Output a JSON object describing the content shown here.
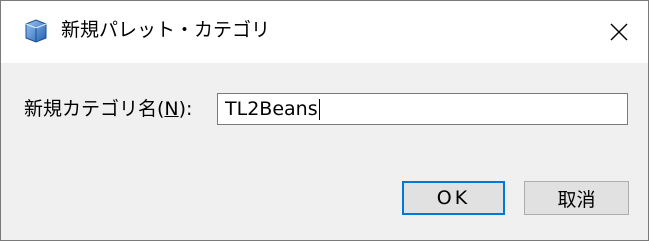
{
  "window": {
    "title": "新規パレット・カテゴリ",
    "close_glyph": "✕"
  },
  "form": {
    "label_before": "新規カテゴリ名(",
    "label_mnemonic": "N",
    "label_after": "):",
    "input_value": "TL2Beans"
  },
  "buttons": {
    "ok_label": "OK",
    "cancel_label": "取消"
  },
  "colors": {
    "default_button_border": "#0078d7",
    "icon_blue": "#3b86d8"
  }
}
